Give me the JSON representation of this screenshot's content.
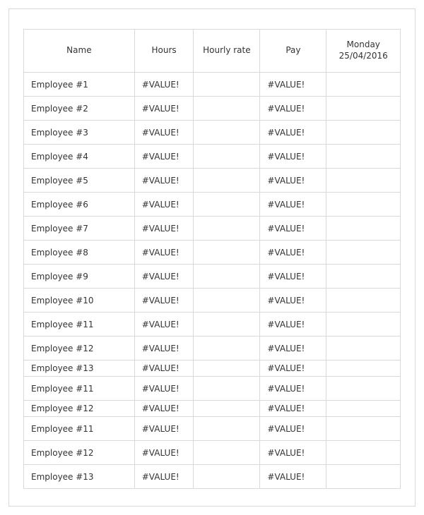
{
  "table": {
    "headers": {
      "name": "Name",
      "hours": "Hours",
      "rate": "Hourly rate",
      "pay": "Pay",
      "day": "Monday 25/04/2016"
    },
    "rows": [
      {
        "name": "Employee #1",
        "hours": "#VALUE!",
        "rate": "",
        "pay": "#VALUE!",
        "day": "",
        "tight": false
      },
      {
        "name": "Employee #2",
        "hours": "#VALUE!",
        "rate": "",
        "pay": "#VALUE!",
        "day": "",
        "tight": false
      },
      {
        "name": "Employee #3",
        "hours": "#VALUE!",
        "rate": "",
        "pay": "#VALUE!",
        "day": "",
        "tight": false
      },
      {
        "name": "Employee #4",
        "hours": "#VALUE!",
        "rate": "",
        "pay": "#VALUE!",
        "day": "",
        "tight": false
      },
      {
        "name": "Employee #5",
        "hours": "#VALUE!",
        "rate": "",
        "pay": "#VALUE!",
        "day": "",
        "tight": false
      },
      {
        "name": "Employee #6",
        "hours": "#VALUE!",
        "rate": "",
        "pay": "#VALUE!",
        "day": "",
        "tight": false
      },
      {
        "name": "Employee #7",
        "hours": "#VALUE!",
        "rate": "",
        "pay": "#VALUE!",
        "day": "",
        "tight": false
      },
      {
        "name": "Employee #8",
        "hours": "#VALUE!",
        "rate": "",
        "pay": "#VALUE!",
        "day": "",
        "tight": false
      },
      {
        "name": "Employee #9",
        "hours": "#VALUE!",
        "rate": "",
        "pay": "#VALUE!",
        "day": "",
        "tight": false
      },
      {
        "name": "Employee #10",
        "hours": "#VALUE!",
        "rate": "",
        "pay": "#VALUE!",
        "day": "",
        "tight": false
      },
      {
        "name": "Employee #11",
        "hours": "#VALUE!",
        "rate": "",
        "pay": "#VALUE!",
        "day": "",
        "tight": false
      },
      {
        "name": "Employee #12",
        "hours": "#VALUE!",
        "rate": "",
        "pay": "#VALUE!",
        "day": "",
        "tight": false
      },
      {
        "name": "Employee #13",
        "hours": "#VALUE!",
        "rate": "",
        "pay": "#VALUE!",
        "day": "",
        "tight": true
      },
      {
        "name": "Employee #11",
        "hours": "#VALUE!",
        "rate": "",
        "pay": "#VALUE!",
        "day": "",
        "tight": false
      },
      {
        "name": "Employee #12",
        "hours": "#VALUE!",
        "rate": "",
        "pay": "#VALUE!",
        "day": "",
        "tight": true
      },
      {
        "name": "Employee #11",
        "hours": "#VALUE!",
        "rate": "",
        "pay": "#VALUE!",
        "day": "",
        "tight": false
      },
      {
        "name": "Employee #12",
        "hours": "#VALUE!",
        "rate": "",
        "pay": "#VALUE!",
        "day": "",
        "tight": false
      },
      {
        "name": "Employee #13",
        "hours": "#VALUE!",
        "rate": "",
        "pay": "#VALUE!",
        "day": "",
        "tight": false
      }
    ]
  }
}
